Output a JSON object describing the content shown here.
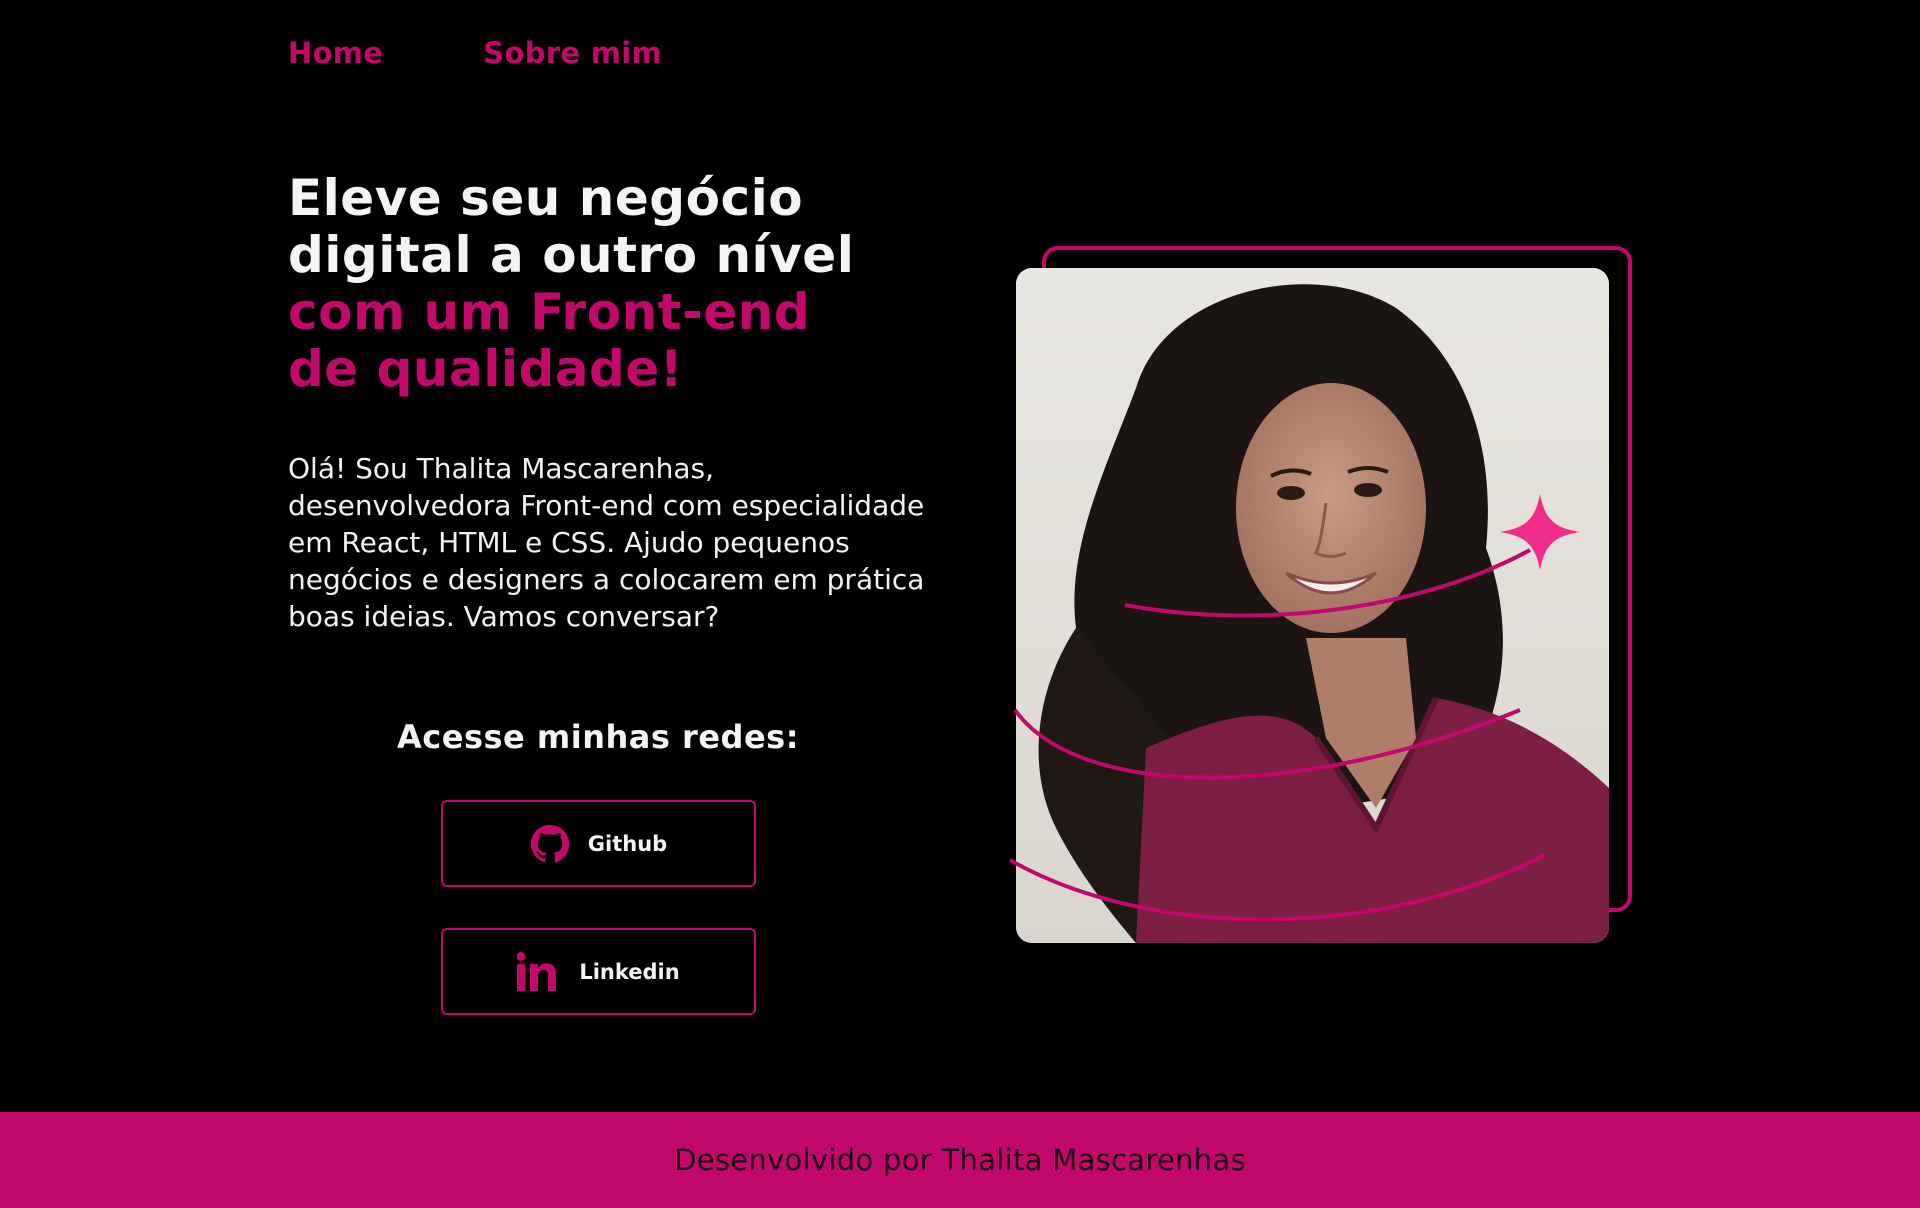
{
  "nav": {
    "items": [
      {
        "label": "Home"
      },
      {
        "label": "Sobre mim"
      }
    ]
  },
  "hero": {
    "headline_white_1": "Eleve seu negócio",
    "headline_white_2": "digital a outro nível",
    "headline_pink_1": "com um Front-end",
    "headline_pink_2": "de qualidade!",
    "intro": "Olá! Sou Thalita Mascarenhas, desenvolvedora Front-end com especialidade em React, HTML e CSS. Ajudo pequenos negócios e designers a colocarem em prática boas ideias. Vamos conversar?"
  },
  "social": {
    "title": "Acesse minhas redes:",
    "github_label": "Github",
    "linkedin_label": "Linkedin",
    "github_icon": "github-icon",
    "linkedin_icon": "linkedin-icon"
  },
  "footer": {
    "text": "Desenvolvido por Thalita Mascarenhas"
  },
  "colors": {
    "accent": "#c2086a",
    "background": "#000000",
    "text": "#f4f4f4"
  }
}
